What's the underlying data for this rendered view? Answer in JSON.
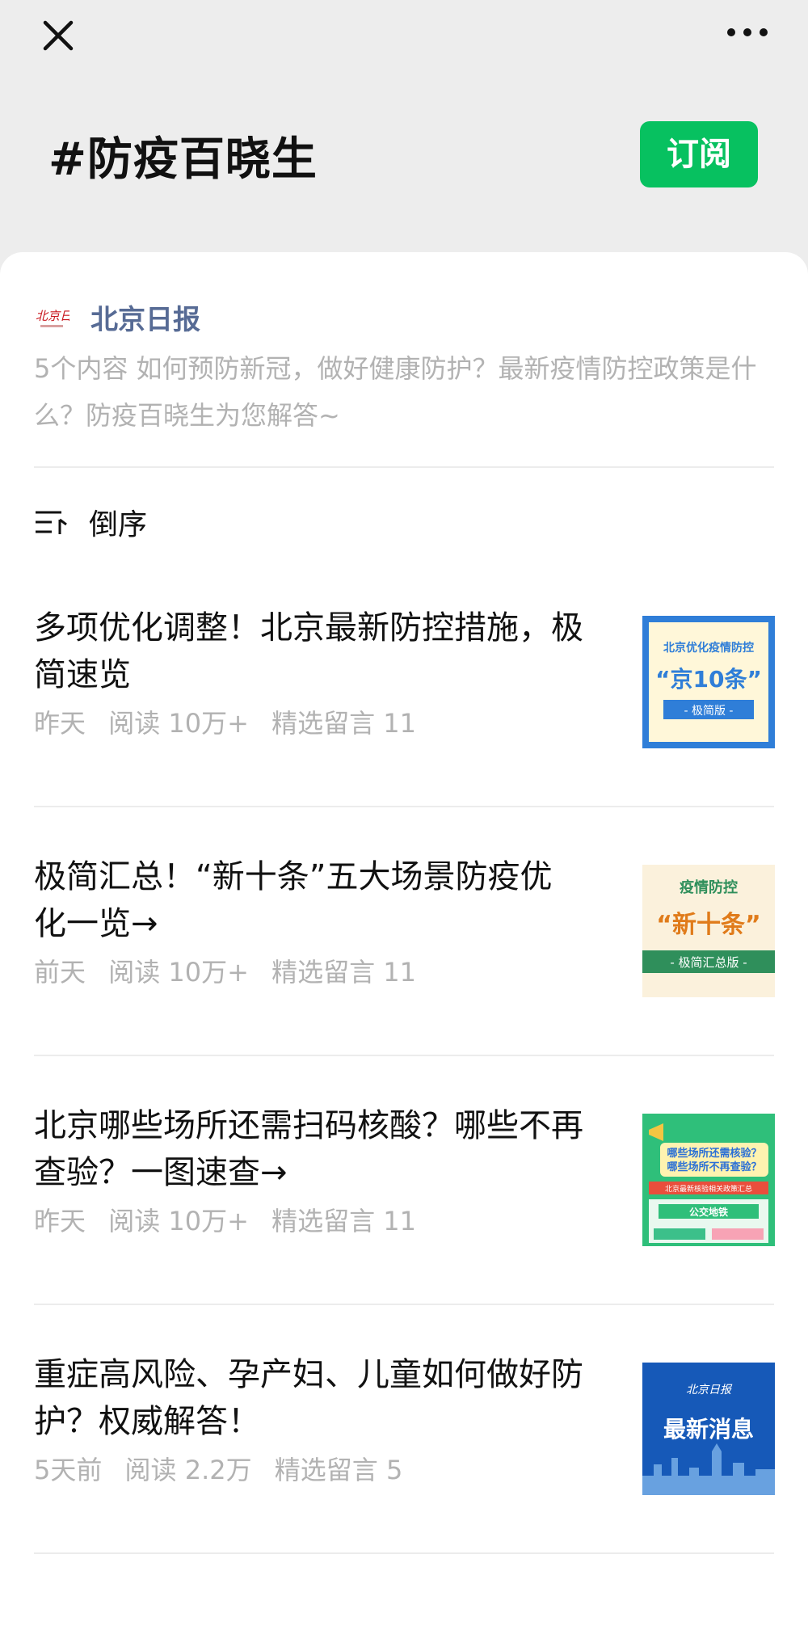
{
  "topbar": {
    "close_icon": "close-icon",
    "more_icon": "more-icon"
  },
  "header": {
    "title": "#防疫百晓生",
    "subscribe_label": "订阅"
  },
  "source": {
    "name": "北京日报",
    "logo_icon": "beijing-daily-logo"
  },
  "intro": "5个内容  如何预防新冠，做好健康防护？最新疫情防控政策是什么？防疫百晓生为您解答~",
  "sort": {
    "label": "倒序",
    "icon": "sort-icon"
  },
  "articles": [
    {
      "title": "多项优化调整！北京最新防控措施，极简速览",
      "time": "昨天",
      "reads": "阅读 10万+",
      "comments": "精选留言 11",
      "thumb": {
        "line1": "北京优化疫情防控",
        "big": "“京10条”",
        "tag": "- 极简版 -"
      }
    },
    {
      "title": "极简汇总！“新十条”五大场景防疫优化一览→",
      "time": "前天",
      "reads": "阅读 10万+",
      "comments": "精选留言 11",
      "thumb": {
        "line1": "疫情防控",
        "big": "“新十条”",
        "tag": "- 极简汇总版 -"
      }
    },
    {
      "title": "北京哪些场所还需扫码核酸？哪些不再查验？一图速查→",
      "time": "昨天",
      "reads": "阅读 10万+",
      "comments": "精选留言 11",
      "thumb": {
        "line1": "哪些场所还需核验？",
        "line2": "哪些场所不再查验？",
        "sub": "北京最新核验相关政策汇总",
        "tag": "公交地铁"
      }
    },
    {
      "title": "重症高风险、孕产妇、儿童如何做好防护？权威解答！",
      "time": "5天前",
      "reads": "阅读 2.2万",
      "comments": "精选留言 5",
      "thumb": {
        "logo": "北京日报",
        "big": "最新消息"
      }
    }
  ],
  "colors": {
    "accent": "#07c160",
    "link": "#576b95",
    "meta": "#b2b2b2"
  }
}
